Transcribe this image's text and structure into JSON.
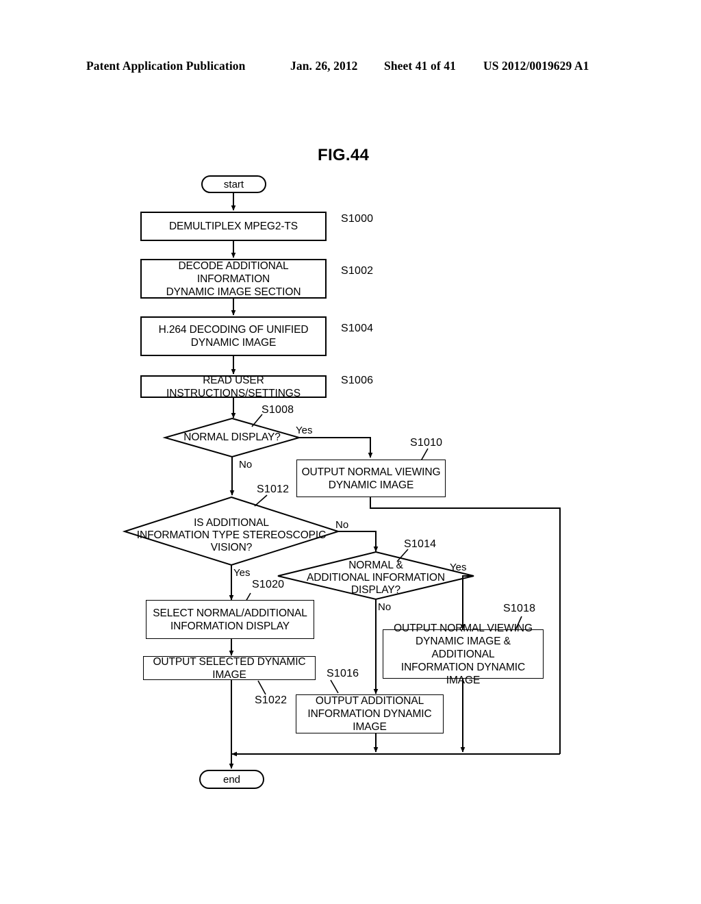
{
  "header": {
    "publication": "Patent Application Publication",
    "date": "Jan. 26, 2012",
    "sheet": "Sheet 41 of 41",
    "number": "US 2012/0019629 A1"
  },
  "figure": {
    "title": "FIG.44"
  },
  "chart_data": {
    "type": "diagram",
    "diagram_type": "flowchart",
    "title": "FIG.44",
    "nodes": [
      {
        "id": "start",
        "shape": "terminator",
        "text": "start"
      },
      {
        "id": "S1000",
        "shape": "process",
        "step": "S1000",
        "text": "DEMULTIPLEX MPEG2-TS"
      },
      {
        "id": "S1002",
        "shape": "process",
        "step": "S1002",
        "text": "DECODE ADDITIONAL INFORMATION DYNAMIC IMAGE SECTION"
      },
      {
        "id": "S1004",
        "shape": "process",
        "step": "S1004",
        "text": "H.264 DECODING OF UNIFIED DYNAMIC IMAGE"
      },
      {
        "id": "S1006",
        "shape": "process",
        "step": "S1006",
        "text": "READ USER INSTRUCTIONS/SETTINGS"
      },
      {
        "id": "S1008",
        "shape": "decision",
        "step": "S1008",
        "text": "NORMAL DISPLAY?"
      },
      {
        "id": "S1010",
        "shape": "process",
        "step": "S1010",
        "text": "OUTPUT NORMAL VIEWING DYNAMIC IMAGE"
      },
      {
        "id": "S1012",
        "shape": "decision",
        "step": "S1012",
        "text": "IS ADDITIONAL INFORMATION TYPE STEREOSCOPIC VISION?"
      },
      {
        "id": "S1014",
        "shape": "decision",
        "step": "S1014",
        "text": "NORMAL & ADDITIONAL INFORMATION DISPLAY?"
      },
      {
        "id": "S1016",
        "shape": "process",
        "step": "S1016",
        "text": "OUTPUT ADDITIONAL INFORMATION DYNAMIC IMAGE"
      },
      {
        "id": "S1018",
        "shape": "process",
        "step": "S1018",
        "text": "OUTPUT NORMAL VIEWING DYNAMIC IMAGE & ADDITIONAL INFORMATION DYNAMIC IMAGE"
      },
      {
        "id": "S1020",
        "shape": "process",
        "step": "S1020",
        "text": "SELECT NORMAL/ADDITIONAL INFORMATION DISPLAY"
      },
      {
        "id": "S1022",
        "shape": "process",
        "step": "S1022",
        "text": "OUTPUT SELECTED DYNAMIC IMAGE"
      },
      {
        "id": "end",
        "shape": "terminator",
        "text": "end"
      }
    ],
    "edges": [
      {
        "from": "start",
        "to": "S1000",
        "label": ""
      },
      {
        "from": "S1000",
        "to": "S1002",
        "label": ""
      },
      {
        "from": "S1002",
        "to": "S1004",
        "label": ""
      },
      {
        "from": "S1004",
        "to": "S1006",
        "label": ""
      },
      {
        "from": "S1006",
        "to": "S1008",
        "label": ""
      },
      {
        "from": "S1008",
        "to": "S1010",
        "label": "Yes"
      },
      {
        "from": "S1008",
        "to": "S1012",
        "label": "No"
      },
      {
        "from": "S1010",
        "to": "end",
        "label": ""
      },
      {
        "from": "S1012",
        "to": "S1020",
        "label": "Yes"
      },
      {
        "from": "S1012",
        "to": "S1014",
        "label": "No"
      },
      {
        "from": "S1014",
        "to": "S1018",
        "label": "Yes"
      },
      {
        "from": "S1014",
        "to": "S1016",
        "label": "No"
      },
      {
        "from": "S1016",
        "to": "end",
        "label": ""
      },
      {
        "from": "S1018",
        "to": "end",
        "label": ""
      },
      {
        "from": "S1020",
        "to": "S1022",
        "label": ""
      },
      {
        "from": "S1022",
        "to": "end",
        "label": ""
      }
    ]
  },
  "nodes": {
    "start": {
      "text": "start"
    },
    "s1000": {
      "text": "DEMULTIPLEX MPEG2-TS",
      "step": "S1000"
    },
    "s1002": {
      "line1": "DECODE ADDITIONAL INFORMATION",
      "line2": "DYNAMIC IMAGE SECTION",
      "step": "S1002"
    },
    "s1004": {
      "line1": "H.264 DECODING OF UNIFIED",
      "line2": "DYNAMIC IMAGE",
      "step": "S1004"
    },
    "s1006": {
      "text": "READ USER INSTRUCTIONS/SETTINGS",
      "step": "S1006"
    },
    "s1008": {
      "text": "NORMAL DISPLAY?",
      "step": "S1008",
      "yes": "Yes",
      "no": "No"
    },
    "s1010": {
      "line1": "OUTPUT NORMAL VIEWING",
      "line2": "DYNAMIC IMAGE",
      "step": "S1010"
    },
    "s1012": {
      "line1": "IS ADDITIONAL",
      "line2": "INFORMATION TYPE STEREOSCOPIC",
      "line3": "VISION?",
      "step": "S1012",
      "yes": "Yes",
      "no": "No"
    },
    "s1014": {
      "line1": "NORMAL &",
      "line2": "ADDITIONAL INFORMATION",
      "line3": "DISPLAY?",
      "step": "S1014",
      "yes": "Yes",
      "no": "No"
    },
    "s1016": {
      "line1": "OUTPUT ADDITIONAL",
      "line2": "INFORMATION DYNAMIC IMAGE",
      "step": "S1016"
    },
    "s1018": {
      "line1": "OUTPUT NORMAL VIEWING",
      "line2": "DYNAMIC IMAGE & ADDITIONAL",
      "line3": "INFORMATION DYNAMIC IMAGE",
      "step": "S1018"
    },
    "s1020": {
      "line1": "SELECT NORMAL/ADDITIONAL",
      "line2": "INFORMATION DISPLAY",
      "step": "S1020"
    },
    "s1022": {
      "text": "OUTPUT SELECTED DYNAMIC IMAGE",
      "step": "S1022"
    },
    "end": {
      "text": "end"
    }
  },
  "colors": {
    "ink": "#000000",
    "paper": "#ffffff"
  }
}
